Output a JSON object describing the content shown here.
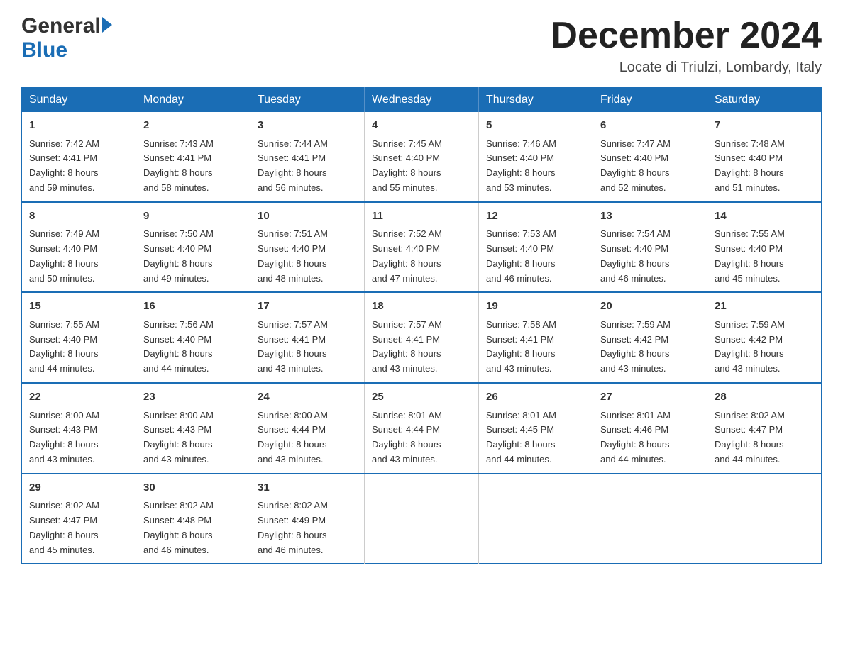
{
  "header": {
    "logo_general": "General",
    "logo_blue": "Blue",
    "month_title": "December 2024",
    "subtitle": "Locate di Triulzi, Lombardy, Italy"
  },
  "days_of_week": [
    "Sunday",
    "Monday",
    "Tuesday",
    "Wednesday",
    "Thursday",
    "Friday",
    "Saturday"
  ],
  "weeks": [
    [
      {
        "day": "1",
        "sunrise": "Sunrise: 7:42 AM",
        "sunset": "Sunset: 4:41 PM",
        "daylight": "Daylight: 8 hours",
        "daylight2": "and 59 minutes."
      },
      {
        "day": "2",
        "sunrise": "Sunrise: 7:43 AM",
        "sunset": "Sunset: 4:41 PM",
        "daylight": "Daylight: 8 hours",
        "daylight2": "and 58 minutes."
      },
      {
        "day": "3",
        "sunrise": "Sunrise: 7:44 AM",
        "sunset": "Sunset: 4:41 PM",
        "daylight": "Daylight: 8 hours",
        "daylight2": "and 56 minutes."
      },
      {
        "day": "4",
        "sunrise": "Sunrise: 7:45 AM",
        "sunset": "Sunset: 4:40 PM",
        "daylight": "Daylight: 8 hours",
        "daylight2": "and 55 minutes."
      },
      {
        "day": "5",
        "sunrise": "Sunrise: 7:46 AM",
        "sunset": "Sunset: 4:40 PM",
        "daylight": "Daylight: 8 hours",
        "daylight2": "and 53 minutes."
      },
      {
        "day": "6",
        "sunrise": "Sunrise: 7:47 AM",
        "sunset": "Sunset: 4:40 PM",
        "daylight": "Daylight: 8 hours",
        "daylight2": "and 52 minutes."
      },
      {
        "day": "7",
        "sunrise": "Sunrise: 7:48 AM",
        "sunset": "Sunset: 4:40 PM",
        "daylight": "Daylight: 8 hours",
        "daylight2": "and 51 minutes."
      }
    ],
    [
      {
        "day": "8",
        "sunrise": "Sunrise: 7:49 AM",
        "sunset": "Sunset: 4:40 PM",
        "daylight": "Daylight: 8 hours",
        "daylight2": "and 50 minutes."
      },
      {
        "day": "9",
        "sunrise": "Sunrise: 7:50 AM",
        "sunset": "Sunset: 4:40 PM",
        "daylight": "Daylight: 8 hours",
        "daylight2": "and 49 minutes."
      },
      {
        "day": "10",
        "sunrise": "Sunrise: 7:51 AM",
        "sunset": "Sunset: 4:40 PM",
        "daylight": "Daylight: 8 hours",
        "daylight2": "and 48 minutes."
      },
      {
        "day": "11",
        "sunrise": "Sunrise: 7:52 AM",
        "sunset": "Sunset: 4:40 PM",
        "daylight": "Daylight: 8 hours",
        "daylight2": "and 47 minutes."
      },
      {
        "day": "12",
        "sunrise": "Sunrise: 7:53 AM",
        "sunset": "Sunset: 4:40 PM",
        "daylight": "Daylight: 8 hours",
        "daylight2": "and 46 minutes."
      },
      {
        "day": "13",
        "sunrise": "Sunrise: 7:54 AM",
        "sunset": "Sunset: 4:40 PM",
        "daylight": "Daylight: 8 hours",
        "daylight2": "and 46 minutes."
      },
      {
        "day": "14",
        "sunrise": "Sunrise: 7:55 AM",
        "sunset": "Sunset: 4:40 PM",
        "daylight": "Daylight: 8 hours",
        "daylight2": "and 45 minutes."
      }
    ],
    [
      {
        "day": "15",
        "sunrise": "Sunrise: 7:55 AM",
        "sunset": "Sunset: 4:40 PM",
        "daylight": "Daylight: 8 hours",
        "daylight2": "and 44 minutes."
      },
      {
        "day": "16",
        "sunrise": "Sunrise: 7:56 AM",
        "sunset": "Sunset: 4:40 PM",
        "daylight": "Daylight: 8 hours",
        "daylight2": "and 44 minutes."
      },
      {
        "day": "17",
        "sunrise": "Sunrise: 7:57 AM",
        "sunset": "Sunset: 4:41 PM",
        "daylight": "Daylight: 8 hours",
        "daylight2": "and 43 minutes."
      },
      {
        "day": "18",
        "sunrise": "Sunrise: 7:57 AM",
        "sunset": "Sunset: 4:41 PM",
        "daylight": "Daylight: 8 hours",
        "daylight2": "and 43 minutes."
      },
      {
        "day": "19",
        "sunrise": "Sunrise: 7:58 AM",
        "sunset": "Sunset: 4:41 PM",
        "daylight": "Daylight: 8 hours",
        "daylight2": "and 43 minutes."
      },
      {
        "day": "20",
        "sunrise": "Sunrise: 7:59 AM",
        "sunset": "Sunset: 4:42 PM",
        "daylight": "Daylight: 8 hours",
        "daylight2": "and 43 minutes."
      },
      {
        "day": "21",
        "sunrise": "Sunrise: 7:59 AM",
        "sunset": "Sunset: 4:42 PM",
        "daylight": "Daylight: 8 hours",
        "daylight2": "and 43 minutes."
      }
    ],
    [
      {
        "day": "22",
        "sunrise": "Sunrise: 8:00 AM",
        "sunset": "Sunset: 4:43 PM",
        "daylight": "Daylight: 8 hours",
        "daylight2": "and 43 minutes."
      },
      {
        "day": "23",
        "sunrise": "Sunrise: 8:00 AM",
        "sunset": "Sunset: 4:43 PM",
        "daylight": "Daylight: 8 hours",
        "daylight2": "and 43 minutes."
      },
      {
        "day": "24",
        "sunrise": "Sunrise: 8:00 AM",
        "sunset": "Sunset: 4:44 PM",
        "daylight": "Daylight: 8 hours",
        "daylight2": "and 43 minutes."
      },
      {
        "day": "25",
        "sunrise": "Sunrise: 8:01 AM",
        "sunset": "Sunset: 4:44 PM",
        "daylight": "Daylight: 8 hours",
        "daylight2": "and 43 minutes."
      },
      {
        "day": "26",
        "sunrise": "Sunrise: 8:01 AM",
        "sunset": "Sunset: 4:45 PM",
        "daylight": "Daylight: 8 hours",
        "daylight2": "and 44 minutes."
      },
      {
        "day": "27",
        "sunrise": "Sunrise: 8:01 AM",
        "sunset": "Sunset: 4:46 PM",
        "daylight": "Daylight: 8 hours",
        "daylight2": "and 44 minutes."
      },
      {
        "day": "28",
        "sunrise": "Sunrise: 8:02 AM",
        "sunset": "Sunset: 4:47 PM",
        "daylight": "Daylight: 8 hours",
        "daylight2": "and 44 minutes."
      }
    ],
    [
      {
        "day": "29",
        "sunrise": "Sunrise: 8:02 AM",
        "sunset": "Sunset: 4:47 PM",
        "daylight": "Daylight: 8 hours",
        "daylight2": "and 45 minutes."
      },
      {
        "day": "30",
        "sunrise": "Sunrise: 8:02 AM",
        "sunset": "Sunset: 4:48 PM",
        "daylight": "Daylight: 8 hours",
        "daylight2": "and 46 minutes."
      },
      {
        "day": "31",
        "sunrise": "Sunrise: 8:02 AM",
        "sunset": "Sunset: 4:49 PM",
        "daylight": "Daylight: 8 hours",
        "daylight2": "and 46 minutes."
      },
      null,
      null,
      null,
      null
    ]
  ]
}
